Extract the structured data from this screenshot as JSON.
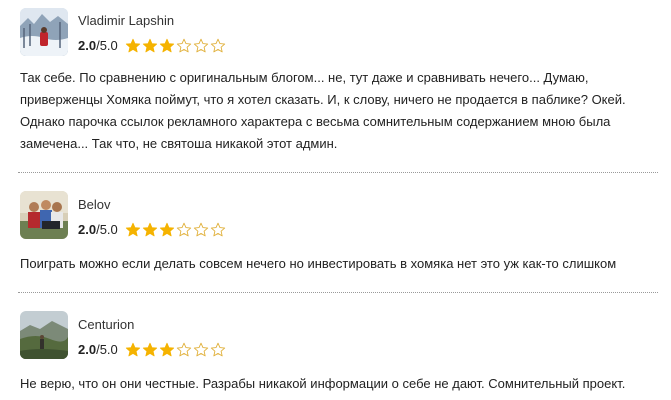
{
  "reviews": [
    {
      "author": "Vladimir Lapshin",
      "rating": "2.0",
      "rating_max": "/5.0",
      "stars_filled": 3,
      "stars_total": 6,
      "text": "Так себе. По сравнению с оригинальным блогом... не, тут даже и сравнивать нечего... Думаю, приверженцы Хомяка поймут, что я хотел сказать. И, к слову, ничего не продается в паблике? Окей. Однако парочка ссылок рекламного характера с весьма сомнительным содержанием мною была замечена... Так что, не святоша никакой этот админ."
    },
    {
      "author": "Belov",
      "rating": "2.0",
      "rating_max": "/5.0",
      "stars_filled": 3,
      "stars_total": 6,
      "text": "Поиграть можно если делать совсем нечего но инвестировать в хомяка нет это уж как-то слишком"
    },
    {
      "author": "Centurion",
      "rating": "2.0",
      "rating_max": "/5.0",
      "stars_filled": 3,
      "stars_total": 6,
      "text": "Не верю, что он они честные. Разрабы никакой информации о себе не дают. Сомнительный проект."
    }
  ],
  "colors": {
    "star_filled": "#f5b301",
    "star_empty": "#e0b03a",
    "divider": "#9a9a9a"
  },
  "icons": {
    "star_filled": "star-filled-icon",
    "star_empty": "star-outline-icon"
  }
}
